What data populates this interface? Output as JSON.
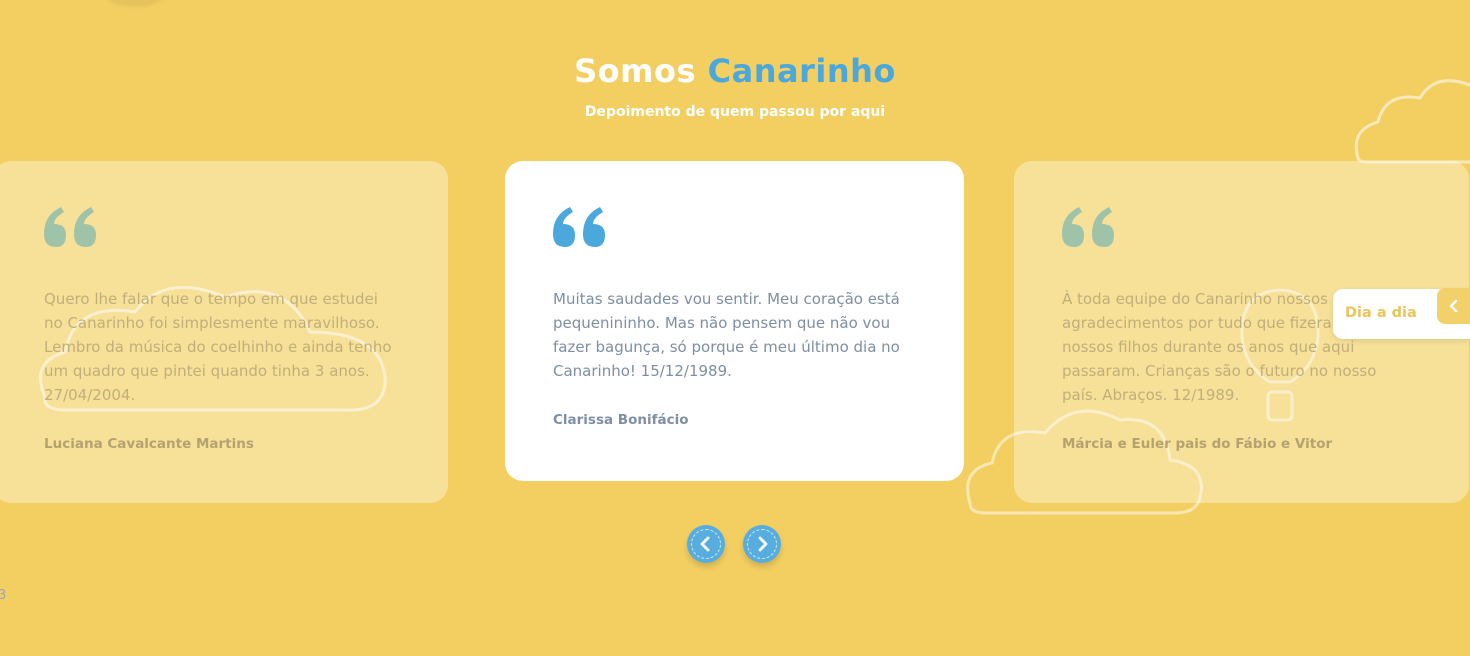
{
  "header": {
    "title_prefix": "Somos",
    "title_accent": "Canarinho",
    "subtitle": "Depoimento de quem passou por aqui"
  },
  "testimonials": [
    {
      "text": "Quero lhe falar que o tempo em que estudei no Canarinho foi simplesmente maravilhoso. Lembro da música do coelhinho e ainda tenho um quadro que pintei quando tinha 3 anos. 27/04/2004.",
      "author": "Luciana Cavalcante Martins"
    },
    {
      "text": "Muitas saudades vou sentir. Meu coração está pequenininho. Mas não pensem que não vou fazer bagunça, só porque é meu último dia no Canarinho! 15/12/1989.",
      "author": "Clarissa Bonifácio"
    },
    {
      "text": "À toda equipe do Canarinho nossos sinceros agradecimentos por tudo que fizeram pelos nossos filhos durante os anos que aqui passaram. Crianças são o futuro no nosso país. Abraços. 12/1989.",
      "author": "Márcia e Euler pais do Fábio e Vitor"
    }
  ],
  "side_tab": {
    "label": "Dia a dia"
  },
  "page_indicator": "3",
  "colors": {
    "background": "#f3cf62",
    "accent_blue": "#4aa8dd",
    "quote_active": "#4aa8dd",
    "quote_inactive": "#9fc3a8",
    "tab_text": "#ebc55a"
  },
  "icons": {
    "quote": "quote-icon",
    "prev": "chevron-left-icon",
    "next": "chevron-right-icon",
    "tab": "chevron-left-icon"
  }
}
